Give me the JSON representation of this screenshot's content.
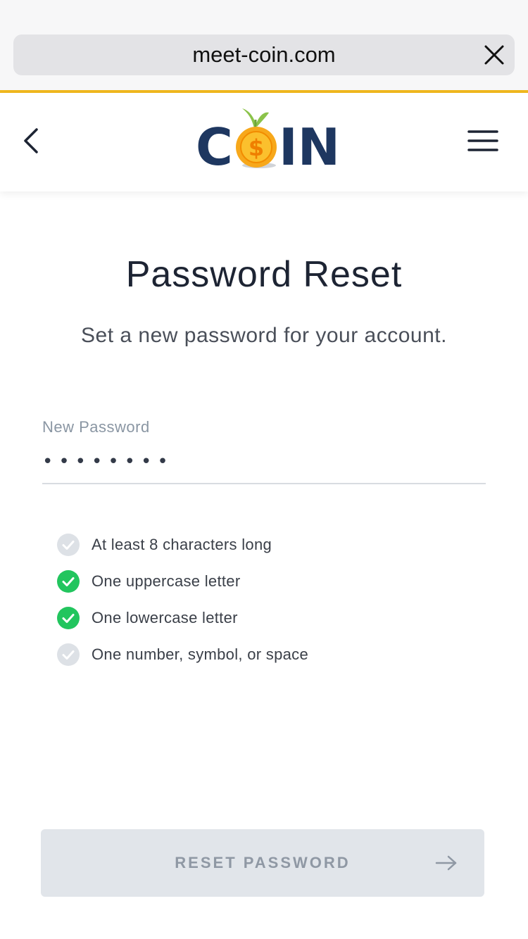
{
  "browser": {
    "url": "meet-coin.com"
  },
  "header": {
    "logo_text_left": "C",
    "logo_text_right": "IN",
    "logo_coin_symbol": "$",
    "icons": {
      "back": "chevron-left-icon",
      "menu": "hamburger-menu-icon",
      "close": "close-icon"
    }
  },
  "main": {
    "title": "Password Reset",
    "subtitle": "Set a new password for your account.",
    "password_field": {
      "label": "New Password",
      "value": "••••••••"
    },
    "requirements": [
      {
        "label": "At least 8 characters long",
        "met": false
      },
      {
        "label": "One uppercase letter",
        "met": true
      },
      {
        "label": "One lowercase letter",
        "met": true
      },
      {
        "label": "One number, symbol, or space",
        "met": false
      }
    ],
    "submit_button": {
      "label": "RESET PASSWORD",
      "icon": "arrow-right-icon"
    }
  },
  "colors": {
    "accent": "#f0b81e",
    "brand_navy": "#1e3760",
    "check_met": "#22c55e",
    "check_unmet": "#dde1e6",
    "button_disabled": "#e1e5ea"
  }
}
